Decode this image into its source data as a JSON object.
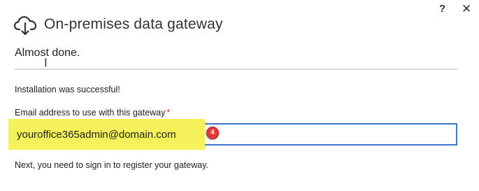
{
  "window": {
    "help_glyph": "?",
    "close_glyph": "✕"
  },
  "header": {
    "icon": "cloud-upload-icon",
    "title": "On-premises data gateway"
  },
  "subtitle": "Almost done.",
  "status": "Installation was successful!",
  "email": {
    "label": "Email address to use with this gateway",
    "required_mark": "*",
    "value": "youroffice365admin@domain.com",
    "highlight_color": "#f5f15a",
    "border_color": "#3c78c3"
  },
  "annotation": {
    "step_number": "4",
    "color": "#e53935"
  },
  "next_message": "Next, you need to sign in to register your gateway."
}
